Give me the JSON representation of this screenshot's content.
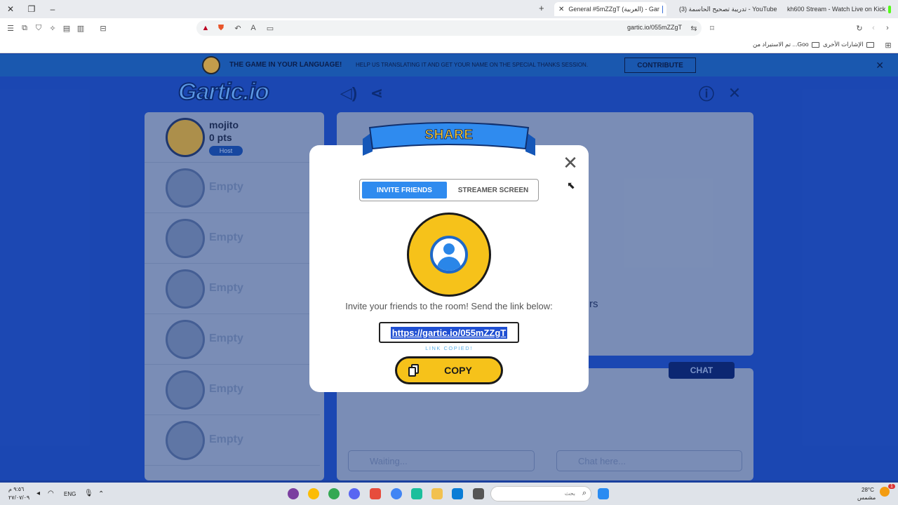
{
  "browser": {
    "tabs": [
      {
        "title": "General #5mZZgT (العربية) - Gar",
        "active": true,
        "favicon_color": "#3b6fd6"
      },
      {
        "title": "(3) تدريبة تصحيح الحاسمة - YouTube",
        "active": false,
        "favicon_color": "#e62117"
      },
      {
        "title": "kh600 Stream - Watch Live on Kick",
        "active": false,
        "favicon_color": "#53fc18"
      }
    ],
    "address": "gartic.io/055mZZgT",
    "bookmarks": [
      {
        "label": "الإشارات الأخرى"
      },
      {
        "label": "تم الاستيراد من ...Goo"
      }
    ]
  },
  "page": {
    "banner": {
      "title": "THE GAME IN YOUR LANGUAGE!",
      "subtitle": "HELP US TRANSLATING IT AND GET YOUR NAME ON THE SPECIAL THANKS SESSION.",
      "contribute_label": "CONTRIBUTE"
    },
    "logo_text": "Gartic.io",
    "players": {
      "me": {
        "name": "mojito",
        "points": "0 pts",
        "badge": "Host"
      },
      "empty_label": "Empty"
    },
    "stage_text": "rs",
    "chat_tab_label": "CHAT",
    "answer_placeholder": "Waiting...",
    "chat_placeholder": "Chat here..."
  },
  "modal": {
    "title": "SHARE",
    "tabs": [
      {
        "label": "INVITE FRIENDS",
        "selected": true
      },
      {
        "label": "STREAMER SCREEN",
        "selected": false
      }
    ],
    "invite_text": "Invite your friends to the room! Send the link below:",
    "link": "https://gartic.io/055mZZgT",
    "copied_text": "LINK COPIED!",
    "copy_label": "COPY"
  },
  "taskbar": {
    "weather_temp": "28°C",
    "weather_desc": "مشمس",
    "search_placeholder": "بحث",
    "language": "ENG",
    "time": "٩:٥٦ م",
    "date": "٢٧/٠٧/٠٩",
    "notification_count": "1"
  },
  "colors": {
    "accent_blue": "#2f8bef",
    "accent_yellow": "#f6c21a",
    "page_bg": "#1f4fc4"
  }
}
